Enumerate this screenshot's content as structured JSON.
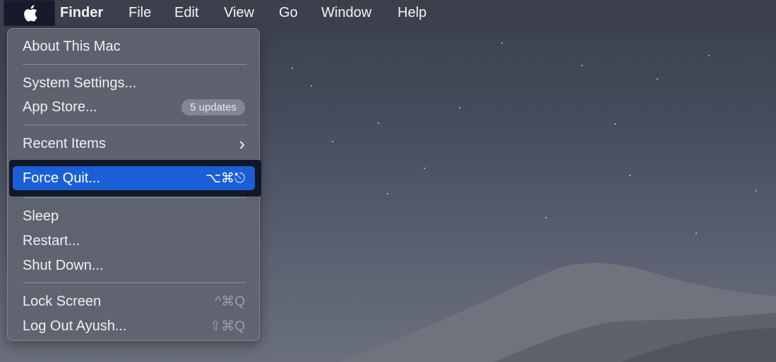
{
  "menubar": {
    "apple_icon": "apple-logo-icon",
    "menus": [
      "Finder",
      "File",
      "Edit",
      "View",
      "Go",
      "Window",
      "Help"
    ]
  },
  "apple_menu": {
    "about": "About This Mac",
    "system_settings": "System Settings...",
    "app_store": "App Store...",
    "app_store_badge": "5 updates",
    "recent_items": "Recent Items",
    "recent_items_arrow": "›",
    "force_quit": "Force Quit...",
    "force_quit_shortcut": "⌥⌘⎋",
    "sleep": "Sleep",
    "restart": "Restart...",
    "shut_down": "Shut Down...",
    "lock_screen": "Lock Screen",
    "lock_screen_shortcut": "^⌘Q",
    "log_out": "Log Out Ayush...",
    "log_out_shortcut": "⇧⌘Q"
  },
  "colors": {
    "highlight": "#1b5fd6",
    "menu_bg": "#606470",
    "highlight_frame": "#11182a"
  }
}
